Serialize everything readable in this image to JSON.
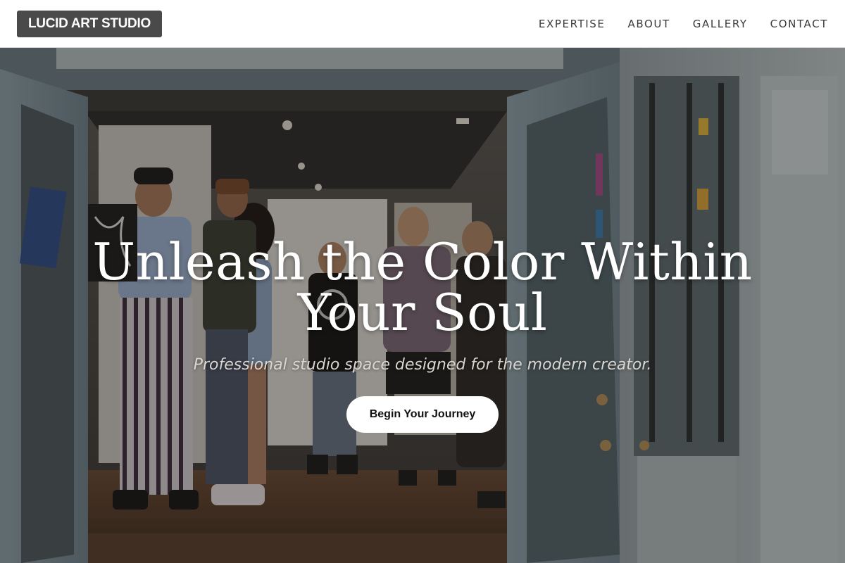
{
  "header": {
    "logo_text": "LUCID ART STUDIO",
    "nav": [
      {
        "label": "EXPERTISE"
      },
      {
        "label": "ABOUT"
      },
      {
        "label": "GALLERY"
      },
      {
        "label": "CONTACT"
      }
    ]
  },
  "hero": {
    "headline_line1": "Unleash the Color Within",
    "headline_line2": "Your Soul",
    "tagline": "Professional studio space designed for the modern creator.",
    "cta_label": "Begin Your Journey",
    "background_description_icon": "gallery-entrance-photo"
  },
  "colors": {
    "header_bg": "#ffffff",
    "logo_bg": "#4a4a4a",
    "cta_bg": "#ffffff",
    "headline": "#ffffff"
  }
}
